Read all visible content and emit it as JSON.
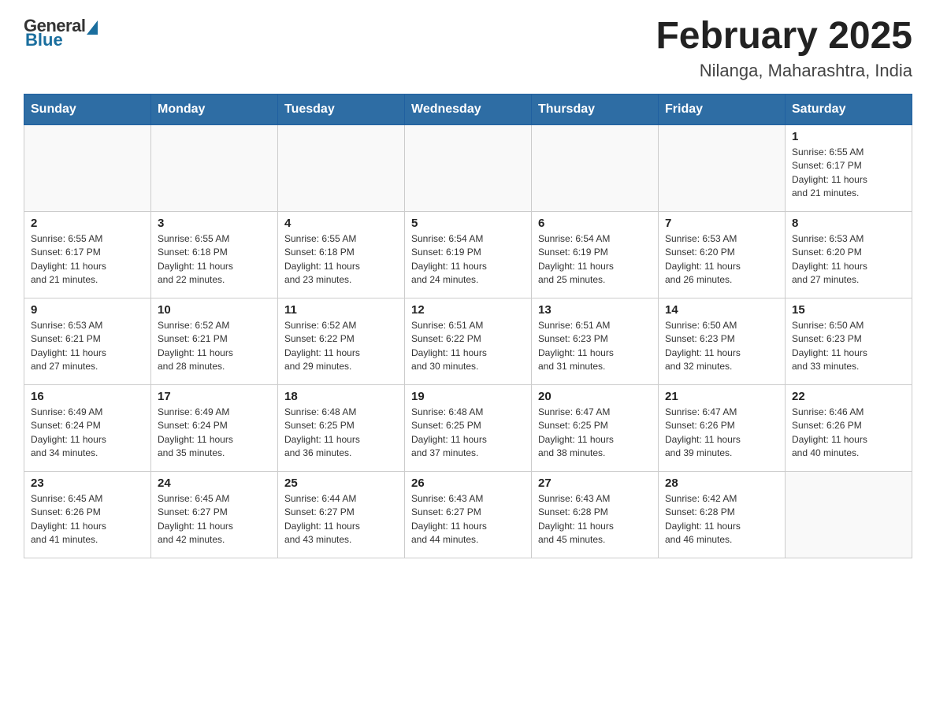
{
  "logo": {
    "general": "General",
    "blue": "Blue"
  },
  "title": "February 2025",
  "subtitle": "Nilanga, Maharashtra, India",
  "days_of_week": [
    "Sunday",
    "Monday",
    "Tuesday",
    "Wednesday",
    "Thursday",
    "Friday",
    "Saturday"
  ],
  "weeks": [
    [
      {
        "day": "",
        "info": ""
      },
      {
        "day": "",
        "info": ""
      },
      {
        "day": "",
        "info": ""
      },
      {
        "day": "",
        "info": ""
      },
      {
        "day": "",
        "info": ""
      },
      {
        "day": "",
        "info": ""
      },
      {
        "day": "1",
        "info": "Sunrise: 6:55 AM\nSunset: 6:17 PM\nDaylight: 11 hours\nand 21 minutes."
      }
    ],
    [
      {
        "day": "2",
        "info": "Sunrise: 6:55 AM\nSunset: 6:17 PM\nDaylight: 11 hours\nand 21 minutes."
      },
      {
        "day": "3",
        "info": "Sunrise: 6:55 AM\nSunset: 6:18 PM\nDaylight: 11 hours\nand 22 minutes."
      },
      {
        "day": "4",
        "info": "Sunrise: 6:55 AM\nSunset: 6:18 PM\nDaylight: 11 hours\nand 23 minutes."
      },
      {
        "day": "5",
        "info": "Sunrise: 6:54 AM\nSunset: 6:19 PM\nDaylight: 11 hours\nand 24 minutes."
      },
      {
        "day": "6",
        "info": "Sunrise: 6:54 AM\nSunset: 6:19 PM\nDaylight: 11 hours\nand 25 minutes."
      },
      {
        "day": "7",
        "info": "Sunrise: 6:53 AM\nSunset: 6:20 PM\nDaylight: 11 hours\nand 26 minutes."
      },
      {
        "day": "8",
        "info": "Sunrise: 6:53 AM\nSunset: 6:20 PM\nDaylight: 11 hours\nand 27 minutes."
      }
    ],
    [
      {
        "day": "9",
        "info": "Sunrise: 6:53 AM\nSunset: 6:21 PM\nDaylight: 11 hours\nand 27 minutes."
      },
      {
        "day": "10",
        "info": "Sunrise: 6:52 AM\nSunset: 6:21 PM\nDaylight: 11 hours\nand 28 minutes."
      },
      {
        "day": "11",
        "info": "Sunrise: 6:52 AM\nSunset: 6:22 PM\nDaylight: 11 hours\nand 29 minutes."
      },
      {
        "day": "12",
        "info": "Sunrise: 6:51 AM\nSunset: 6:22 PM\nDaylight: 11 hours\nand 30 minutes."
      },
      {
        "day": "13",
        "info": "Sunrise: 6:51 AM\nSunset: 6:23 PM\nDaylight: 11 hours\nand 31 minutes."
      },
      {
        "day": "14",
        "info": "Sunrise: 6:50 AM\nSunset: 6:23 PM\nDaylight: 11 hours\nand 32 minutes."
      },
      {
        "day": "15",
        "info": "Sunrise: 6:50 AM\nSunset: 6:23 PM\nDaylight: 11 hours\nand 33 minutes."
      }
    ],
    [
      {
        "day": "16",
        "info": "Sunrise: 6:49 AM\nSunset: 6:24 PM\nDaylight: 11 hours\nand 34 minutes."
      },
      {
        "day": "17",
        "info": "Sunrise: 6:49 AM\nSunset: 6:24 PM\nDaylight: 11 hours\nand 35 minutes."
      },
      {
        "day": "18",
        "info": "Sunrise: 6:48 AM\nSunset: 6:25 PM\nDaylight: 11 hours\nand 36 minutes."
      },
      {
        "day": "19",
        "info": "Sunrise: 6:48 AM\nSunset: 6:25 PM\nDaylight: 11 hours\nand 37 minutes."
      },
      {
        "day": "20",
        "info": "Sunrise: 6:47 AM\nSunset: 6:25 PM\nDaylight: 11 hours\nand 38 minutes."
      },
      {
        "day": "21",
        "info": "Sunrise: 6:47 AM\nSunset: 6:26 PM\nDaylight: 11 hours\nand 39 minutes."
      },
      {
        "day": "22",
        "info": "Sunrise: 6:46 AM\nSunset: 6:26 PM\nDaylight: 11 hours\nand 40 minutes."
      }
    ],
    [
      {
        "day": "23",
        "info": "Sunrise: 6:45 AM\nSunset: 6:26 PM\nDaylight: 11 hours\nand 41 minutes."
      },
      {
        "day": "24",
        "info": "Sunrise: 6:45 AM\nSunset: 6:27 PM\nDaylight: 11 hours\nand 42 minutes."
      },
      {
        "day": "25",
        "info": "Sunrise: 6:44 AM\nSunset: 6:27 PM\nDaylight: 11 hours\nand 43 minutes."
      },
      {
        "day": "26",
        "info": "Sunrise: 6:43 AM\nSunset: 6:27 PM\nDaylight: 11 hours\nand 44 minutes."
      },
      {
        "day": "27",
        "info": "Sunrise: 6:43 AM\nSunset: 6:28 PM\nDaylight: 11 hours\nand 45 minutes."
      },
      {
        "day": "28",
        "info": "Sunrise: 6:42 AM\nSunset: 6:28 PM\nDaylight: 11 hours\nand 46 minutes."
      },
      {
        "day": "",
        "info": ""
      }
    ]
  ]
}
